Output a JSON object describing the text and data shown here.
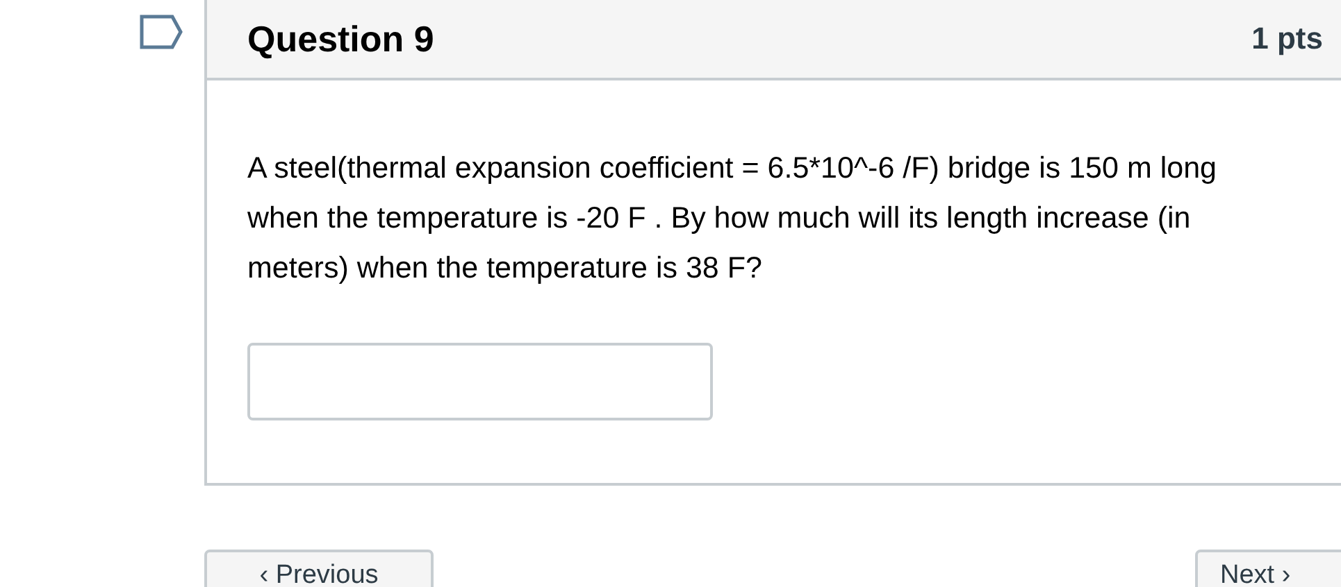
{
  "question": {
    "flagged": false,
    "title": "Question 9",
    "points": "1 pts",
    "text": "A steel(thermal expansion coefficient = 6.5*10^-6 /F) bridge is 150 m long when the temperature is -20 F .  By how much will its length increase (in meters) when the temperature is 38 F?"
  },
  "nav": [
    {
      "kind": "previous",
      "label": "Previous",
      "arrow": "‹"
    },
    {
      "kind": "next",
      "label": "Next",
      "arrow": "›"
    }
  ]
}
